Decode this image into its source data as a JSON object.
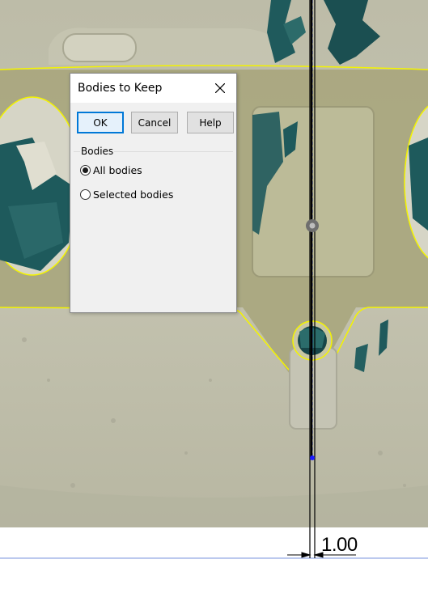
{
  "dialog": {
    "title": "Bodies to Keep",
    "buttons": {
      "ok": "OK",
      "cancel": "Cancel",
      "help": "Help"
    },
    "group_label": "Bodies",
    "options": [
      {
        "label": "All bodies",
        "selected": true
      },
      {
        "label": "Selected bodies",
        "selected": false
      }
    ]
  },
  "dimension": {
    "value": "1.00"
  },
  "colors": {
    "sketch_outline": "#ffff00",
    "surface": "#b9b796",
    "scan_teal": "#1e5a5c",
    "dialog_accent": "#0078d7"
  }
}
